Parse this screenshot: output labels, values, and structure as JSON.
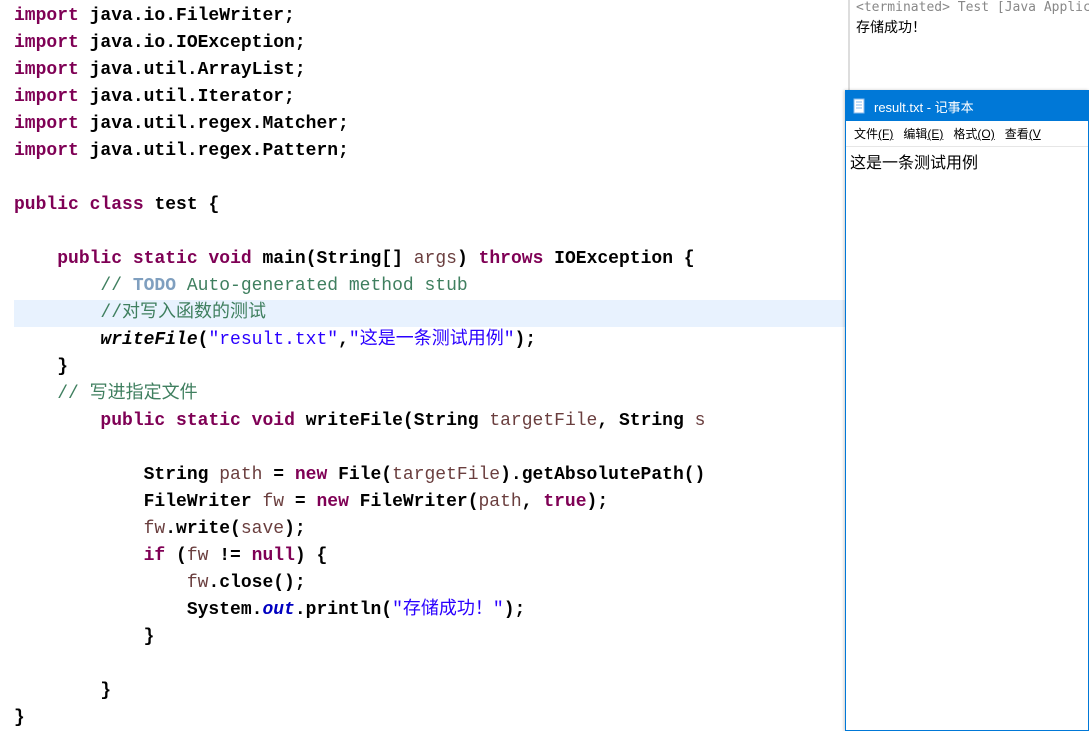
{
  "code": {
    "lines": [
      {
        "type": "import",
        "kw": "import",
        "stmt": " java.io.FileWriter;"
      },
      {
        "type": "import",
        "kw": "import",
        "stmt": " java.io.IOException;"
      },
      {
        "type": "import",
        "kw": "import",
        "stmt": " java.util.ArrayList;"
      },
      {
        "type": "import",
        "kw": "import",
        "stmt": " java.util.Iterator;"
      },
      {
        "type": "import",
        "kw": "import",
        "stmt": " java.util.regex.Matcher;"
      },
      {
        "type": "import",
        "kw": "import",
        "stmt": " java.util.regex.Pattern;"
      }
    ],
    "class_decl": {
      "kw1": "public",
      "kw2": "class",
      "name": "test",
      "brace": "{"
    },
    "main_method": {
      "indent": "    ",
      "kw1": "public",
      "kw2": "static",
      "kw3": "void",
      "name": "main(String[] ",
      "arg": "args",
      "paren": ") ",
      "kw4": "throws",
      "exc": " IOException {"
    },
    "todo_comment": {
      "indent": "        ",
      "prefix": "// ",
      "todo": "TODO",
      "rest": " Auto-generated method stub"
    },
    "test_comment": {
      "indent": "        ",
      "text": "//对写入函数的测试"
    },
    "write_call": {
      "indent": "        ",
      "fn": "writeFile",
      "paren1": "(",
      "str1": "\"result.txt\"",
      "comma": ",",
      "str2": "\"这是一条测试用例\"",
      "paren2": ");"
    },
    "close_main": "    }",
    "file_comment": {
      "indent": "    ",
      "text": "// 写进指定文件"
    },
    "writefile_method": {
      "indent": "        ",
      "kw1": "public",
      "kw2": "static",
      "kw3": "void",
      "name": " writeFile(String ",
      "arg1": "targetFile",
      "mid": ", String ",
      "arg2": "s"
    },
    "path_line": {
      "indent": "            ",
      "type": "String ",
      "var": "path",
      "eq": " = ",
      "kw": "new",
      "rest": " File(",
      "arg": "targetFile",
      "rest2": ").getAbsolutePath()"
    },
    "fw_line": {
      "indent": "            ",
      "type": "FileWriter ",
      "var": "fw",
      "eq": " = ",
      "kw": "new",
      "rest": " FileWriter(",
      "arg1": "path",
      "comma": ", ",
      "kw2": "true",
      "paren": ");"
    },
    "write_line": {
      "indent": "            ",
      "var": "fw",
      "dot": ".write(",
      "arg": "save",
      "paren": ");"
    },
    "if_line": {
      "indent": "            ",
      "kw": "if",
      "paren": " (",
      "var": "fw",
      "neq": " != ",
      "kw2": "null",
      "brace": ") {"
    },
    "close_line": {
      "indent": "                ",
      "var": "fw",
      "rest": ".close();"
    },
    "println_line": {
      "indent": "                ",
      "sys": "System.",
      "out": "out",
      "method": ".println(",
      "str": "\"存储成功！\"",
      "paren": ");"
    },
    "close_if": "            }",
    "close_writefile": "        }",
    "close_class": "}"
  },
  "console": {
    "header": "<terminated> Test [Java Applic",
    "output": "存储成功！"
  },
  "notepad": {
    "title": "result.txt - 记事本",
    "menu": {
      "file": "文件",
      "file_key": "(F)",
      "edit": "编辑",
      "edit_key": "(E)",
      "format": "格式",
      "format_key": "(O)",
      "view": "查看",
      "view_key": "(V"
    },
    "content": "这是一条测试用例"
  }
}
